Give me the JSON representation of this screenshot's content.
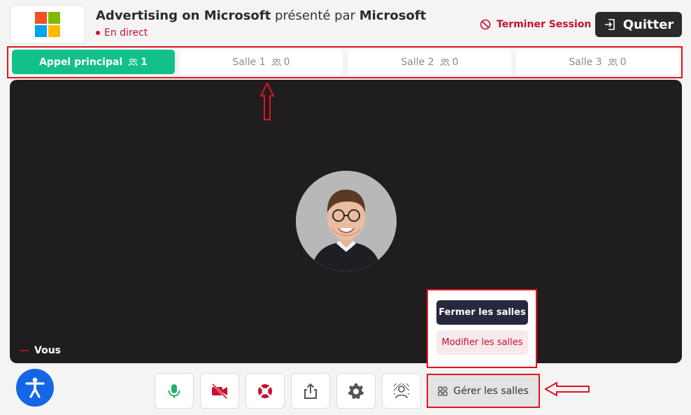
{
  "header": {
    "event_name": "Advertising on Microsoft",
    "presented_by": "présenté par",
    "organizer": "Microsoft",
    "live_status": "En direct",
    "end_session_label": "Terminer Session",
    "quit_label": "Quitter"
  },
  "logo": {
    "icon": "microsoft-logo",
    "colors": [
      "#f25022",
      "#7fba00",
      "#00a4ef",
      "#ffb900"
    ]
  },
  "tabs": [
    {
      "label": "Appel principal",
      "count": "1",
      "active": true
    },
    {
      "label": "Salle 1",
      "count": "0",
      "active": false
    },
    {
      "label": "Salle 2",
      "count": "0",
      "active": false
    },
    {
      "label": "Salle 3",
      "count": "0",
      "active": false
    }
  ],
  "video": {
    "self_label": "Vous"
  },
  "rooms_menu": {
    "close_label": "Fermer les salles",
    "modify_label": "Modifier les salles"
  },
  "toolbar": {
    "buttons": [
      {
        "icon": "microphone-icon",
        "color": "#20b26b"
      },
      {
        "icon": "camera-off-icon",
        "color": "#c8102e"
      },
      {
        "icon": "lifebuoy-icon",
        "color": "#c8102e"
      },
      {
        "icon": "share-icon",
        "color": "#555555"
      },
      {
        "icon": "gear-icon",
        "color": "#555555"
      },
      {
        "icon": "background-blur-icon",
        "color": "#555555"
      }
    ],
    "manage_rooms_label": "Gérer les salles"
  },
  "colors": {
    "accent_green": "#13c08a",
    "danger_red": "#c8102e",
    "annotation_red": "#e0141e",
    "video_bg": "#1f1d1e",
    "accessibility_blue": "#1566e6"
  }
}
